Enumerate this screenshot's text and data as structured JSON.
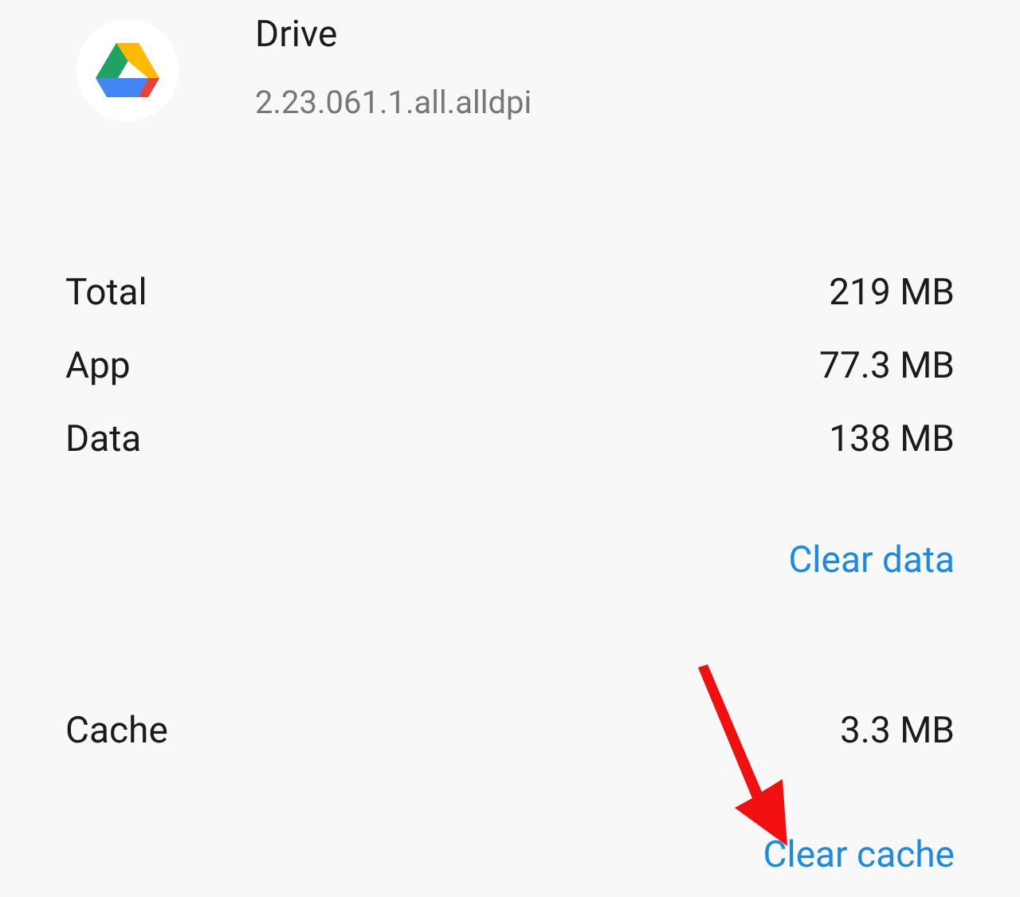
{
  "app": {
    "name": "Drive",
    "version": "2.23.061.1.all.alldpi"
  },
  "storage": [
    {
      "label": "Total",
      "value": "219 MB"
    },
    {
      "label": "App",
      "value": "77.3 MB"
    },
    {
      "label": "Data",
      "value": "138 MB"
    }
  ],
  "clear_data_button": "Clear data",
  "cache": {
    "label": "Cache",
    "value": "3.3 MB"
  },
  "clear_cache_button": "Clear cache"
}
